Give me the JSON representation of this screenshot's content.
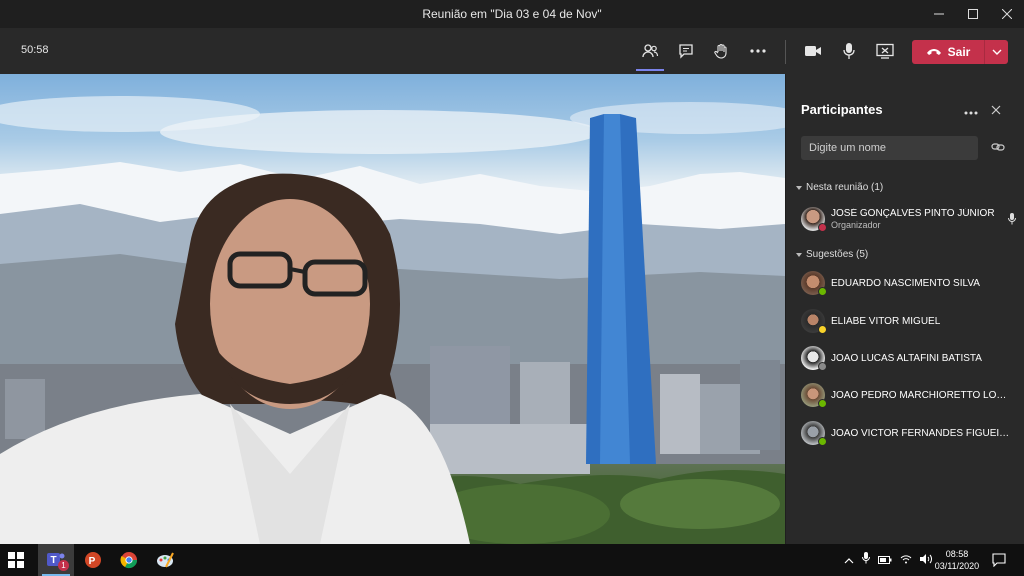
{
  "window": {
    "title": "Reunião em \"Dia 03 e 04 de Nov\""
  },
  "toolbar": {
    "timer": "50:58",
    "leave_label": "Sair"
  },
  "participants_panel": {
    "title": "Participantes",
    "search_placeholder": "Digite um nome",
    "in_meeting_header": "Nesta reunião (1)",
    "in_meeting": [
      {
        "name": "JOSÉ GONÇALVES PINTO JÚNIOR",
        "role": "Organizador",
        "status_color": "#c4314b"
      }
    ],
    "suggestions_header": "Sugestões (5)",
    "suggestions": [
      {
        "name": "EDUARDO NASCIMENTO SILVA",
        "status_color": "#6bb700"
      },
      {
        "name": "ELIABE VITOR MIGUEL",
        "status_color": "#f8d22a"
      },
      {
        "name": "JOAO LUCAS ALTAFINI BATISTA",
        "status_color": "#8a8a8a"
      },
      {
        "name": "JOAO PEDRO MARCHIORETTO LOPES",
        "status_color": "#6bb700"
      },
      {
        "name": "JOAO VICTOR FERNANDES FIGUEIRE...",
        "status_color": "#6bb700"
      }
    ]
  },
  "taskbar": {
    "time": "08:58",
    "date": "03/11/2020",
    "teams_badge": "1",
    "apps": [
      "teams-icon",
      "powerpoint-icon",
      "chrome-icon",
      "paint-icon"
    ]
  },
  "colors": {
    "accent": "#7b83eb",
    "leave": "#c4314b",
    "panel_bg": "#292929",
    "toolbar_bg": "#292929"
  }
}
